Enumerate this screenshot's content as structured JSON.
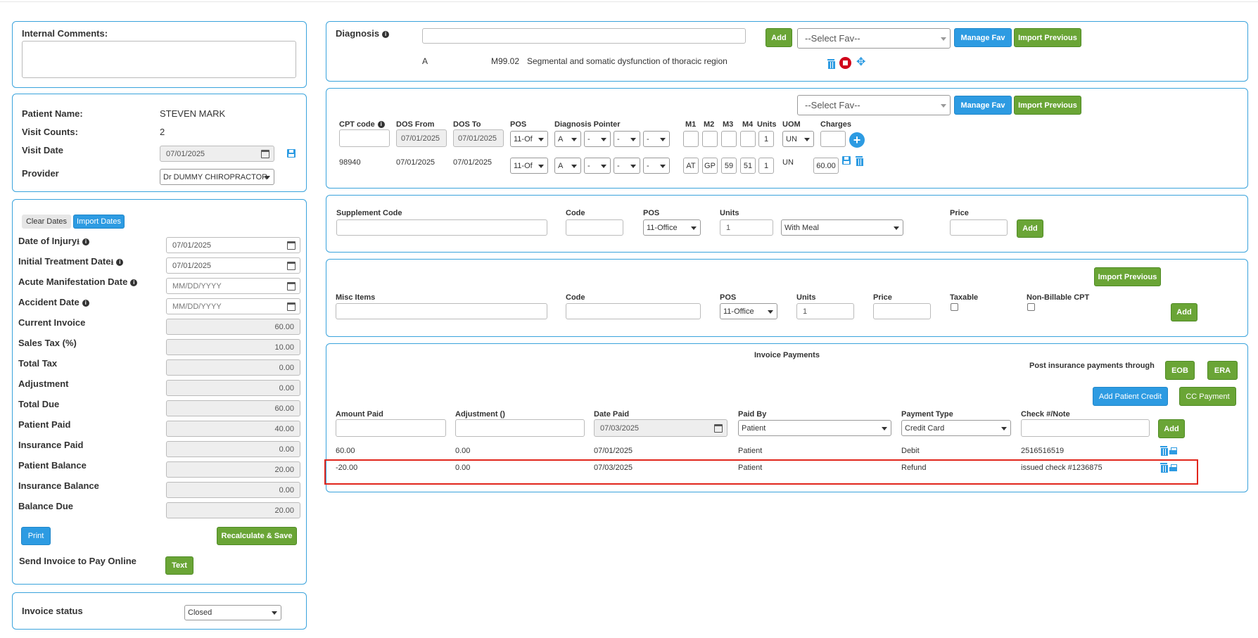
{
  "internal_comments": {
    "label": "Internal Comments:",
    "value": ""
  },
  "patient": {
    "name_label": "Patient Name:",
    "name": "STEVEN MARK",
    "visit_counts_label": "Visit Counts:",
    "visit_counts": "2",
    "visit_date_label": "Visit Date",
    "visit_date": "07/01/2025",
    "provider_label": "Provider",
    "provider": "Dr DUMMY CHIROPRACTOR"
  },
  "dates": {
    "clear_label": "Clear Dates",
    "import_label": "Import Dates",
    "date_of_injury_label": "Date of Injury",
    "date_of_injury": "07/01/2025",
    "initial_treatment_label": "Initial Treatment Date",
    "initial_treatment": "07/01/2025",
    "acute_label": "Acute Manifestation Date",
    "acute_placeholder": "MM/DD/YYYY",
    "accident_label": "Accident Date",
    "accident_placeholder": "MM/DD/YYYY"
  },
  "totals": [
    {
      "label": "Current Invoice",
      "value": "60.00"
    },
    {
      "label": "Sales Tax (%)",
      "value": "10.00"
    },
    {
      "label": "Total Tax",
      "value": "0.00"
    },
    {
      "label": "Adjustment",
      "value": "0.00"
    },
    {
      "label": "Total Due",
      "value": "60.00"
    },
    {
      "label": "Patient Paid",
      "value": "40.00"
    },
    {
      "label": "Insurance Paid",
      "value": "0.00"
    },
    {
      "label": "Patient Balance",
      "value": "20.00"
    },
    {
      "label": "Insurance Balance",
      "value": "0.00"
    },
    {
      "label": "Balance Due",
      "value": "20.00"
    }
  ],
  "actions": {
    "print": "Print",
    "recalc": "Recalculate & Save",
    "send_label": "Send Invoice to Pay Online",
    "text": "Text"
  },
  "invoice_status": {
    "label": "Invoice status",
    "value": "Closed"
  },
  "diagnosis": {
    "title": "Diagnosis",
    "add": "Add",
    "select_fav": "--Select Fav--",
    "manage_fav": "Manage Fav",
    "import_previous": "Import Previous",
    "row": {
      "pointer": "A",
      "code": "M99.02",
      "description": "Segmental and somatic dysfunction of thoracic region"
    }
  },
  "cpt": {
    "select_fav": "--Select Fav--",
    "manage_fav": "Manage Fav",
    "import_previous": "Import Previous",
    "headers": {
      "cpt": "CPT code",
      "dos_from": "DOS From",
      "dos_to": "DOS To",
      "pos": "POS",
      "pointer": "Diagnosis Pointer",
      "m1": "M1",
      "m2": "M2",
      "m3": "M3",
      "m4": "M4",
      "units": "Units",
      "uom": "UOM",
      "charges": "Charges"
    },
    "new_row": {
      "dos_from": "07/01/2025",
      "dos_to": "07/01/2025",
      "pos": "11-Of",
      "p1": "A",
      "p2": "-",
      "p3": "-",
      "p4": "-",
      "units": "1",
      "uom": "UN"
    },
    "row": {
      "cpt": "98940",
      "dos_from": "07/01/2025",
      "dos_to": "07/01/2025",
      "pos": "11-Of",
      "p1": "A",
      "p2": "-",
      "p3": "-",
      "p4": "-",
      "m1": "AT",
      "m2": "GP",
      "m3": "59",
      "m4": "51",
      "units": "1",
      "uom": "UN",
      "charges": "60.00"
    }
  },
  "supplement": {
    "code_label": "Supplement Code",
    "code2_label": "Code",
    "pos_label": "POS",
    "pos": "11-Office",
    "units_label": "Units",
    "units": "1",
    "meal": "With Meal",
    "price_label": "Price",
    "add": "Add"
  },
  "misc": {
    "import_previous": "Import Previous",
    "items_label": "Misc Items",
    "code_label": "Code",
    "pos_label": "POS",
    "pos": "11-Office",
    "units_label": "Units",
    "units": "1",
    "price_label": "Price",
    "taxable_label": "Taxable",
    "nonbillable_label": "Non-Billable CPT",
    "add": "Add"
  },
  "payments": {
    "title": "Invoice Payments",
    "post_label": "Post insurance payments through",
    "eob": "EOB",
    "era": "ERA",
    "add_patient_credit": "Add Patient Credit",
    "cc_payment": "CC Payment",
    "headers": {
      "amount": "Amount Paid",
      "adjustment": "Adjustment ()",
      "date": "Date Paid",
      "paid_by": "Paid By",
      "type": "Payment Type",
      "note": "Check #/Note"
    },
    "new": {
      "date": "07/03/2025",
      "paid_by": "Patient",
      "type": "Credit Card",
      "add": "Add"
    },
    "rows": [
      {
        "amount": "60.00",
        "adjustment": "0.00",
        "date": "07/01/2025",
        "paid_by": "Patient",
        "type": "Debit",
        "note": "2516516519"
      },
      {
        "amount": "-20.00",
        "adjustment": "0.00",
        "date": "07/03/2025",
        "paid_by": "Patient",
        "type": "Refund",
        "note": "issued check #1236875"
      }
    ]
  }
}
